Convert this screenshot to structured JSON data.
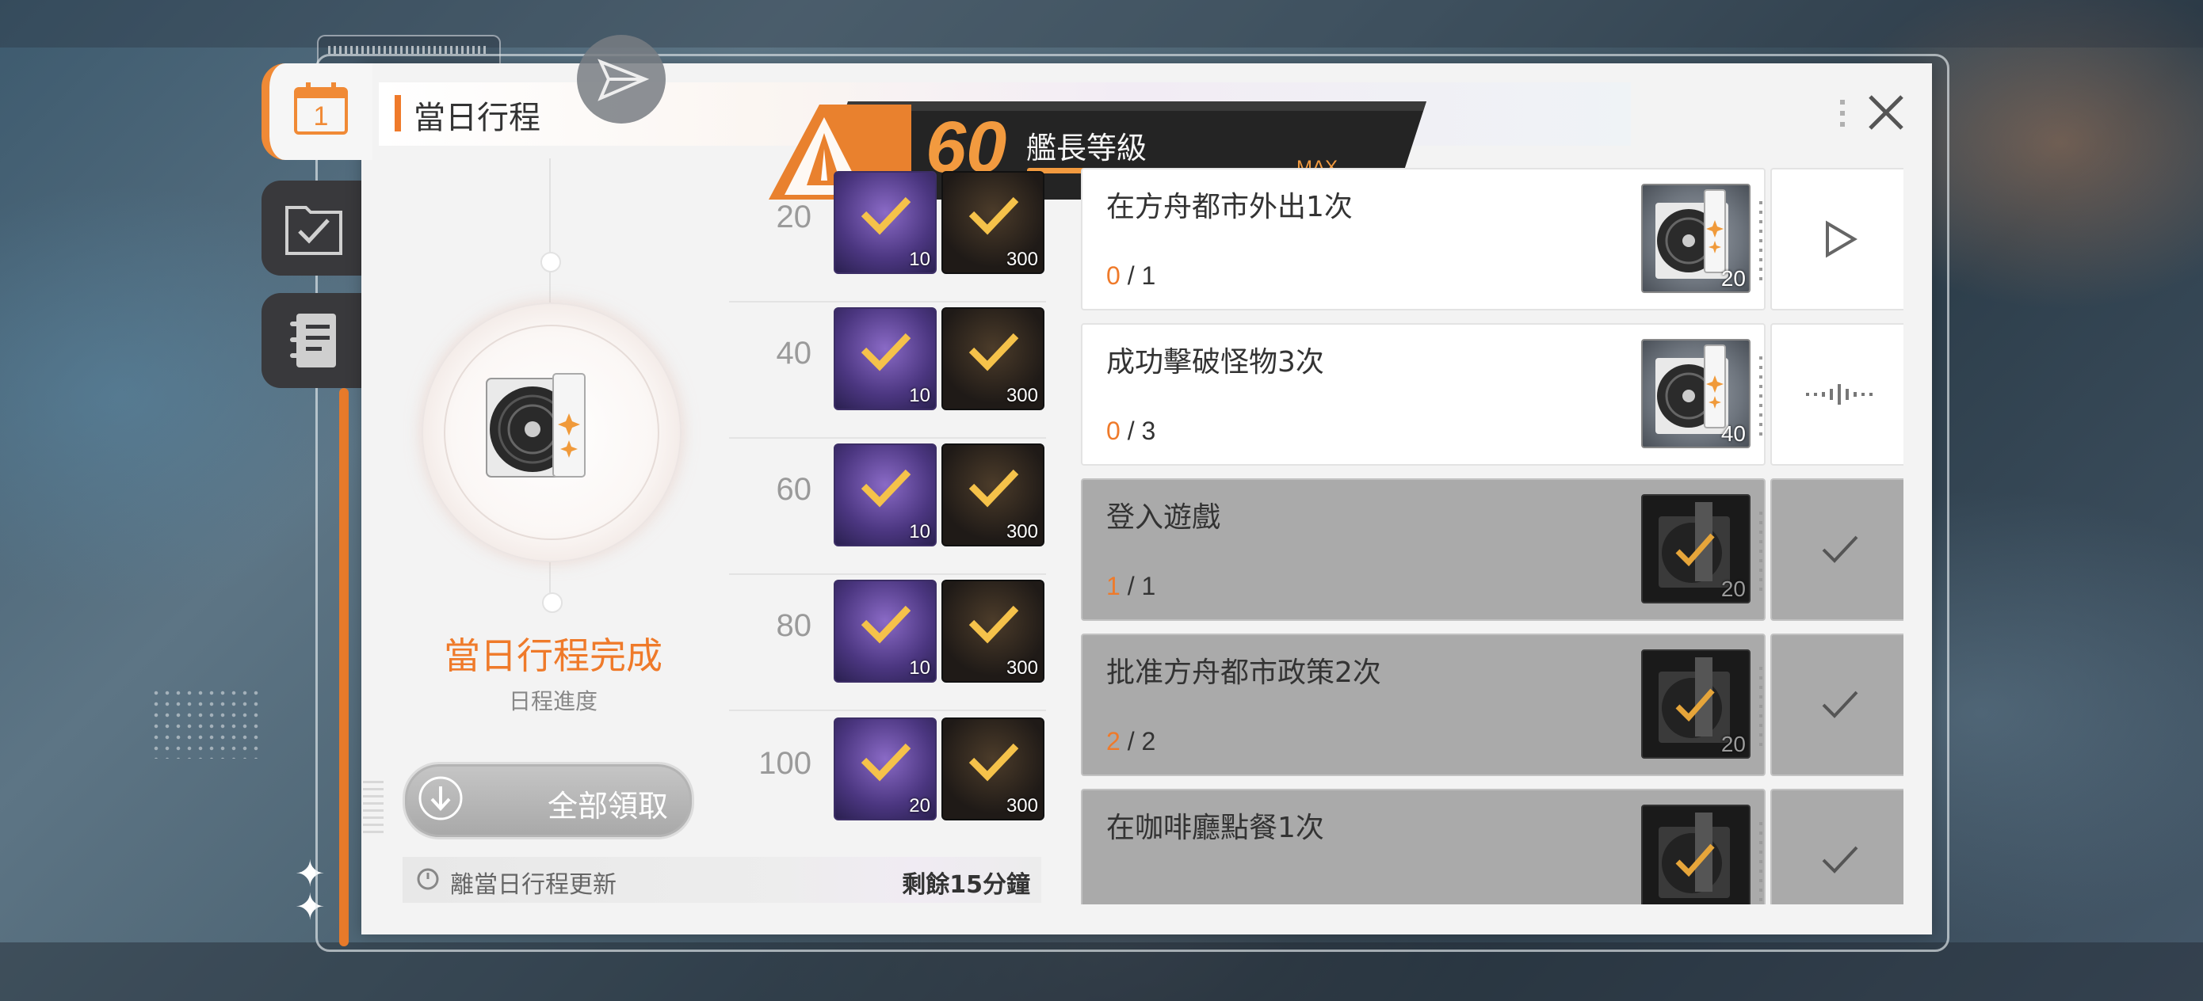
{
  "header": {
    "title": "當日行程"
  },
  "level": {
    "value": "60",
    "label": "艦長等級",
    "max_label": "MAX",
    "progress": 1.0
  },
  "summary": {
    "title": "當日行程完成",
    "subtitle": "日程進度"
  },
  "claim_all": {
    "label": "全部領取"
  },
  "refresh": {
    "label": "離當日行程更新",
    "remaining": "剩餘15分鐘"
  },
  "nav": {
    "calendar_day": "1"
  },
  "rewards": [
    {
      "level": "20",
      "item_a_qty": "10",
      "item_b_qty": "300"
    },
    {
      "level": "40",
      "item_a_qty": "10",
      "item_b_qty": "300"
    },
    {
      "level": "60",
      "item_a_qty": "10",
      "item_b_qty": "300"
    },
    {
      "level": "80",
      "item_a_qty": "10",
      "item_b_qty": "300"
    },
    {
      "level": "100",
      "item_a_qty": "20",
      "item_b_qty": "300"
    }
  ],
  "tasks": [
    {
      "name": "在方舟都市外出1次",
      "current": "0",
      "total": "/ 1",
      "reward_qty": "20",
      "action": "go-icon",
      "done": false
    },
    {
      "name": "成功擊破怪物3次",
      "current": "0",
      "total": "/ 3",
      "reward_qty": "40",
      "action": "in-progress-icon",
      "done": false
    },
    {
      "name": "登入遊戲",
      "current": "1",
      "total": "/ 1",
      "reward_qty": "20",
      "action": "check-icon",
      "done": true
    },
    {
      "name": "批准方舟都市政策2次",
      "current": "2",
      "total": "/ 2",
      "reward_qty": "20",
      "action": "check-icon",
      "done": true
    },
    {
      "name": "在咖啡廳點餐1次",
      "current": "",
      "total": "",
      "reward_qty": "",
      "action": "check-icon",
      "done": true
    }
  ],
  "colors": {
    "accent": "#ef7a2a",
    "done_bg": "#aaaaaa",
    "panel_bg": "#f3f3f3"
  }
}
